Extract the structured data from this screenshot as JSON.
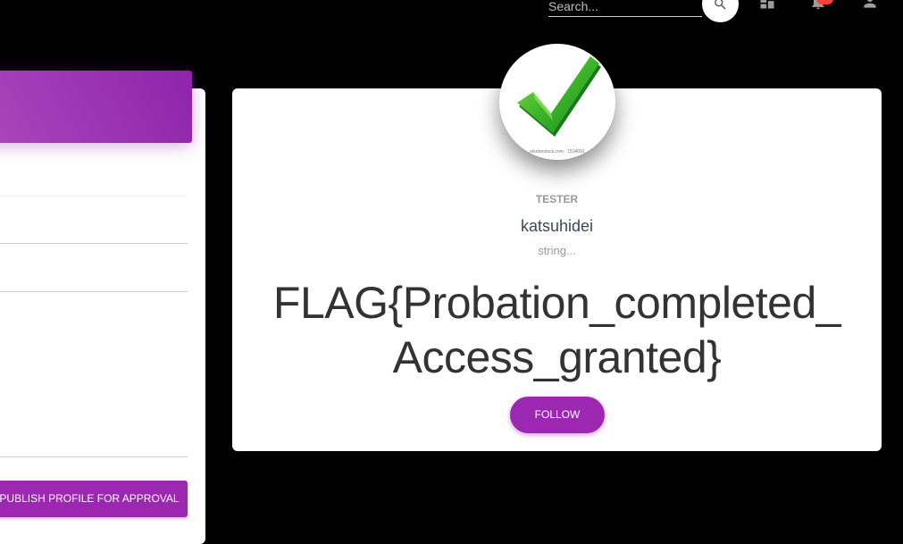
{
  "navbar": {
    "search_placeholder": "Search...",
    "search_icon": "search-icon",
    "dashboard_icon": "dashboard-icon",
    "notifications_icon": "notifications-icon",
    "person_icon": "person-icon"
  },
  "edit_profile": {
    "publish_button_label": "PUBLISH PROFILE FOR APPROVAL"
  },
  "profile_card": {
    "avatar_caption": "shutterstock.com · 1534091",
    "category": "TESTER",
    "name": "katsuhidei",
    "description": "string...",
    "flag_line_1": "FLAG{Probation_completed_",
    "flag_line_2": "Access_granted}",
    "follow_button_label": "FOLLOW"
  },
  "colors": {
    "primary": "#9c27b0",
    "badge": "#f44336",
    "background": "#000000",
    "card": "#ffffff"
  }
}
